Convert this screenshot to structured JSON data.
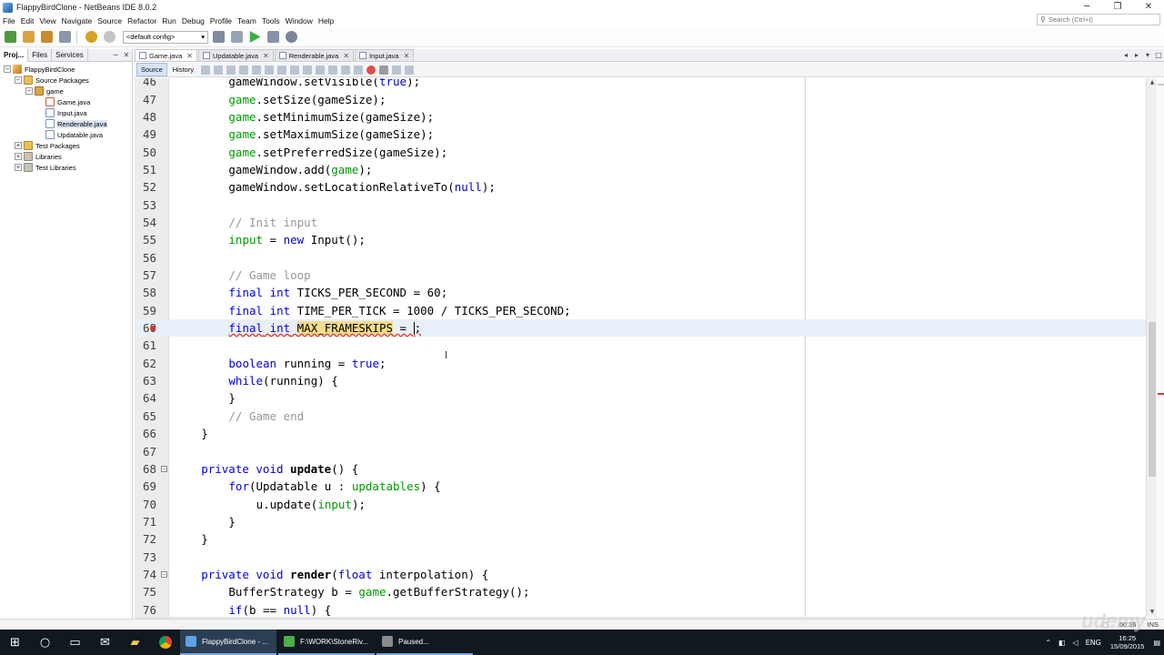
{
  "window": {
    "title": "FlappyBirdClone - NetBeans IDE 8.0.2",
    "minimize": "─",
    "maximize": "❐",
    "close": "✕"
  },
  "menu": [
    "File",
    "Edit",
    "View",
    "Navigate",
    "Source",
    "Refactor",
    "Run",
    "Debug",
    "Profile",
    "Team",
    "Tools",
    "Window",
    "Help"
  ],
  "search": {
    "placeholder": "Search (Ctrl+I)"
  },
  "toolbar": {
    "config": "<default config>"
  },
  "left_panel": {
    "tabs": [
      "Proj...",
      "Files",
      "Services"
    ],
    "tree": [
      {
        "label": "FlappyBirdClone",
        "indent": 0,
        "toggle": "−",
        "icon": "project-icon"
      },
      {
        "label": "Source Packages",
        "indent": 1,
        "toggle": "−",
        "icon": "folder-icon"
      },
      {
        "label": "game",
        "indent": 2,
        "toggle": "−",
        "icon": "package-icon"
      },
      {
        "label": "Game.java",
        "indent": 3,
        "toggle": "",
        "icon": "java-main-icon"
      },
      {
        "label": "Input.java",
        "indent": 3,
        "toggle": "",
        "icon": "java-file-icon"
      },
      {
        "label": "Renderable.java",
        "indent": 3,
        "toggle": "",
        "icon": "java-file-icon",
        "selected": true
      },
      {
        "label": "Updatable.java",
        "indent": 3,
        "toggle": "",
        "icon": "java-file-icon"
      },
      {
        "label": "Test Packages",
        "indent": 1,
        "toggle": "+",
        "icon": "folder-icon"
      },
      {
        "label": "Libraries",
        "indent": 1,
        "toggle": "+",
        "icon": "library-icon"
      },
      {
        "label": "Test Libraries",
        "indent": 1,
        "toggle": "+",
        "icon": "library-icon"
      }
    ]
  },
  "editor": {
    "tabs": [
      "Game.java",
      "Updatable.java",
      "Renderable.java",
      "Input.java"
    ],
    "modes": [
      "Source",
      "History"
    ],
    "lines": [
      {
        "n": "46",
        "indent": 2,
        "tokens": [
          [
            "gameWindow.setVisible(",
            ""
          ],
          [
            "true",
            "kw"
          ],
          [
            ");",
            ""
          ]
        ]
      },
      {
        "n": "47",
        "indent": 2,
        "tokens": [
          [
            "game",
            "fld"
          ],
          [
            ".setSize(gameSize);",
            ""
          ]
        ]
      },
      {
        "n": "48",
        "indent": 2,
        "tokens": [
          [
            "game",
            "fld"
          ],
          [
            ".setMinimumSize(gameSize);",
            ""
          ]
        ]
      },
      {
        "n": "49",
        "indent": 2,
        "tokens": [
          [
            "game",
            "fld"
          ],
          [
            ".setMaximumSize(gameSize);",
            ""
          ]
        ]
      },
      {
        "n": "50",
        "indent": 2,
        "tokens": [
          [
            "game",
            "fld"
          ],
          [
            ".setPreferredSize(gameSize);",
            ""
          ]
        ]
      },
      {
        "n": "51",
        "indent": 2,
        "tokens": [
          [
            "gameWindow.add(",
            ""
          ],
          [
            "game",
            "fld"
          ],
          [
            ");",
            ""
          ]
        ]
      },
      {
        "n": "52",
        "indent": 2,
        "tokens": [
          [
            "gameWindow.setLocationRelativeTo(",
            ""
          ],
          [
            "null",
            "kw"
          ],
          [
            ");",
            ""
          ]
        ]
      },
      {
        "n": "53",
        "indent": 0,
        "tokens": []
      },
      {
        "n": "54",
        "indent": 2,
        "tokens": [
          [
            "// Init input",
            "cm"
          ]
        ]
      },
      {
        "n": "55",
        "indent": 2,
        "tokens": [
          [
            "input",
            "fld"
          ],
          [
            " = ",
            ""
          ],
          [
            "new",
            "kw"
          ],
          [
            " Input();",
            ""
          ]
        ]
      },
      {
        "n": "56",
        "indent": 0,
        "tokens": []
      },
      {
        "n": "57",
        "indent": 2,
        "tokens": [
          [
            "// Game loop",
            "cm"
          ]
        ]
      },
      {
        "n": "58",
        "indent": 2,
        "tokens": [
          [
            "final",
            "kw"
          ],
          [
            " ",
            ""
          ],
          [
            "int",
            "kw"
          ],
          [
            " TICKS_PER_SECOND = 60;",
            ""
          ]
        ]
      },
      {
        "n": "59",
        "indent": 2,
        "tokens": [
          [
            "final",
            "kw"
          ],
          [
            " ",
            ""
          ],
          [
            "int",
            "kw"
          ],
          [
            " TIME_PER_TICK = 1000 / TICKS_PER_SECOND;",
            ""
          ]
        ]
      },
      {
        "n": "60",
        "indent": 2,
        "current": true,
        "error": true,
        "tokens": [
          [
            "final",
            "kw err"
          ],
          [
            " ",
            "err"
          ],
          [
            "int",
            "kw err"
          ],
          [
            " ",
            "err"
          ],
          [
            "MAX_FRAMESKIPS",
            "hl err"
          ],
          [
            " = ",
            "err"
          ],
          [
            "|",
            "caret"
          ],
          [
            ";",
            "err"
          ]
        ]
      },
      {
        "n": "61",
        "indent": 0,
        "tokens": []
      },
      {
        "n": "62",
        "indent": 2,
        "tokens": [
          [
            "boolean",
            "kw"
          ],
          [
            " running = ",
            ""
          ],
          [
            "true",
            "kw"
          ],
          [
            ";",
            ""
          ]
        ]
      },
      {
        "n": "63",
        "indent": 2,
        "tokens": [
          [
            "while",
            "kw"
          ],
          [
            "(running) {",
            ""
          ]
        ]
      },
      {
        "n": "64",
        "indent": 2,
        "tokens": [
          [
            "}",
            ""
          ]
        ]
      },
      {
        "n": "65",
        "indent": 2,
        "tokens": [
          [
            "// Game end",
            "cm"
          ]
        ]
      },
      {
        "n": "66",
        "indent": 1,
        "tokens": [
          [
            "}",
            ""
          ]
        ]
      },
      {
        "n": "67",
        "indent": 0,
        "tokens": []
      },
      {
        "n": "68",
        "indent": 1,
        "fold": "−",
        "tokens": [
          [
            "private",
            "kw"
          ],
          [
            " ",
            ""
          ],
          [
            "void",
            "kw"
          ],
          [
            " ",
            ""
          ],
          [
            "update",
            "bold"
          ],
          [
            "() {",
            ""
          ]
        ]
      },
      {
        "n": "69",
        "indent": 2,
        "tokens": [
          [
            "for",
            "kw"
          ],
          [
            "(Updatable u : ",
            ""
          ],
          [
            "updatables",
            "fld"
          ],
          [
            ") {",
            ""
          ]
        ]
      },
      {
        "n": "70",
        "indent": 3,
        "tokens": [
          [
            "u.update(",
            ""
          ],
          [
            "input",
            "fld"
          ],
          [
            ");",
            ""
          ]
        ]
      },
      {
        "n": "71",
        "indent": 2,
        "tokens": [
          [
            "}",
            ""
          ]
        ]
      },
      {
        "n": "72",
        "indent": 1,
        "tokens": [
          [
            "}",
            ""
          ]
        ]
      },
      {
        "n": "73",
        "indent": 0,
        "tokens": []
      },
      {
        "n": "74",
        "indent": 1,
        "fold": "−",
        "tokens": [
          [
            "private",
            "kw"
          ],
          [
            " ",
            ""
          ],
          [
            "void",
            "kw"
          ],
          [
            " ",
            ""
          ],
          [
            "render",
            "bold"
          ],
          [
            "(",
            ""
          ],
          [
            "float",
            "kw"
          ],
          [
            " interpolation) {",
            ""
          ]
        ]
      },
      {
        "n": "75",
        "indent": 2,
        "tokens": [
          [
            "BufferStrategy b = ",
            ""
          ],
          [
            "game",
            "fld"
          ],
          [
            ".getBufferStrategy();",
            ""
          ]
        ]
      },
      {
        "n": "76",
        "indent": 2,
        "tokens": [
          [
            "if",
            "kw"
          ],
          [
            "(b == ",
            ""
          ],
          [
            "null",
            "kw"
          ],
          [
            ") {",
            ""
          ]
        ]
      }
    ]
  },
  "status": {
    "position": "60:36",
    "mode": "INS"
  },
  "taskbar": {
    "apps": [
      "FlappyBirdClone - ...",
      "F:\\WORK\\StoneRiv...",
      "Paused..."
    ],
    "lang": "ENG",
    "time": "16:25",
    "date": "15/09/2015"
  },
  "watermark": "udemy"
}
